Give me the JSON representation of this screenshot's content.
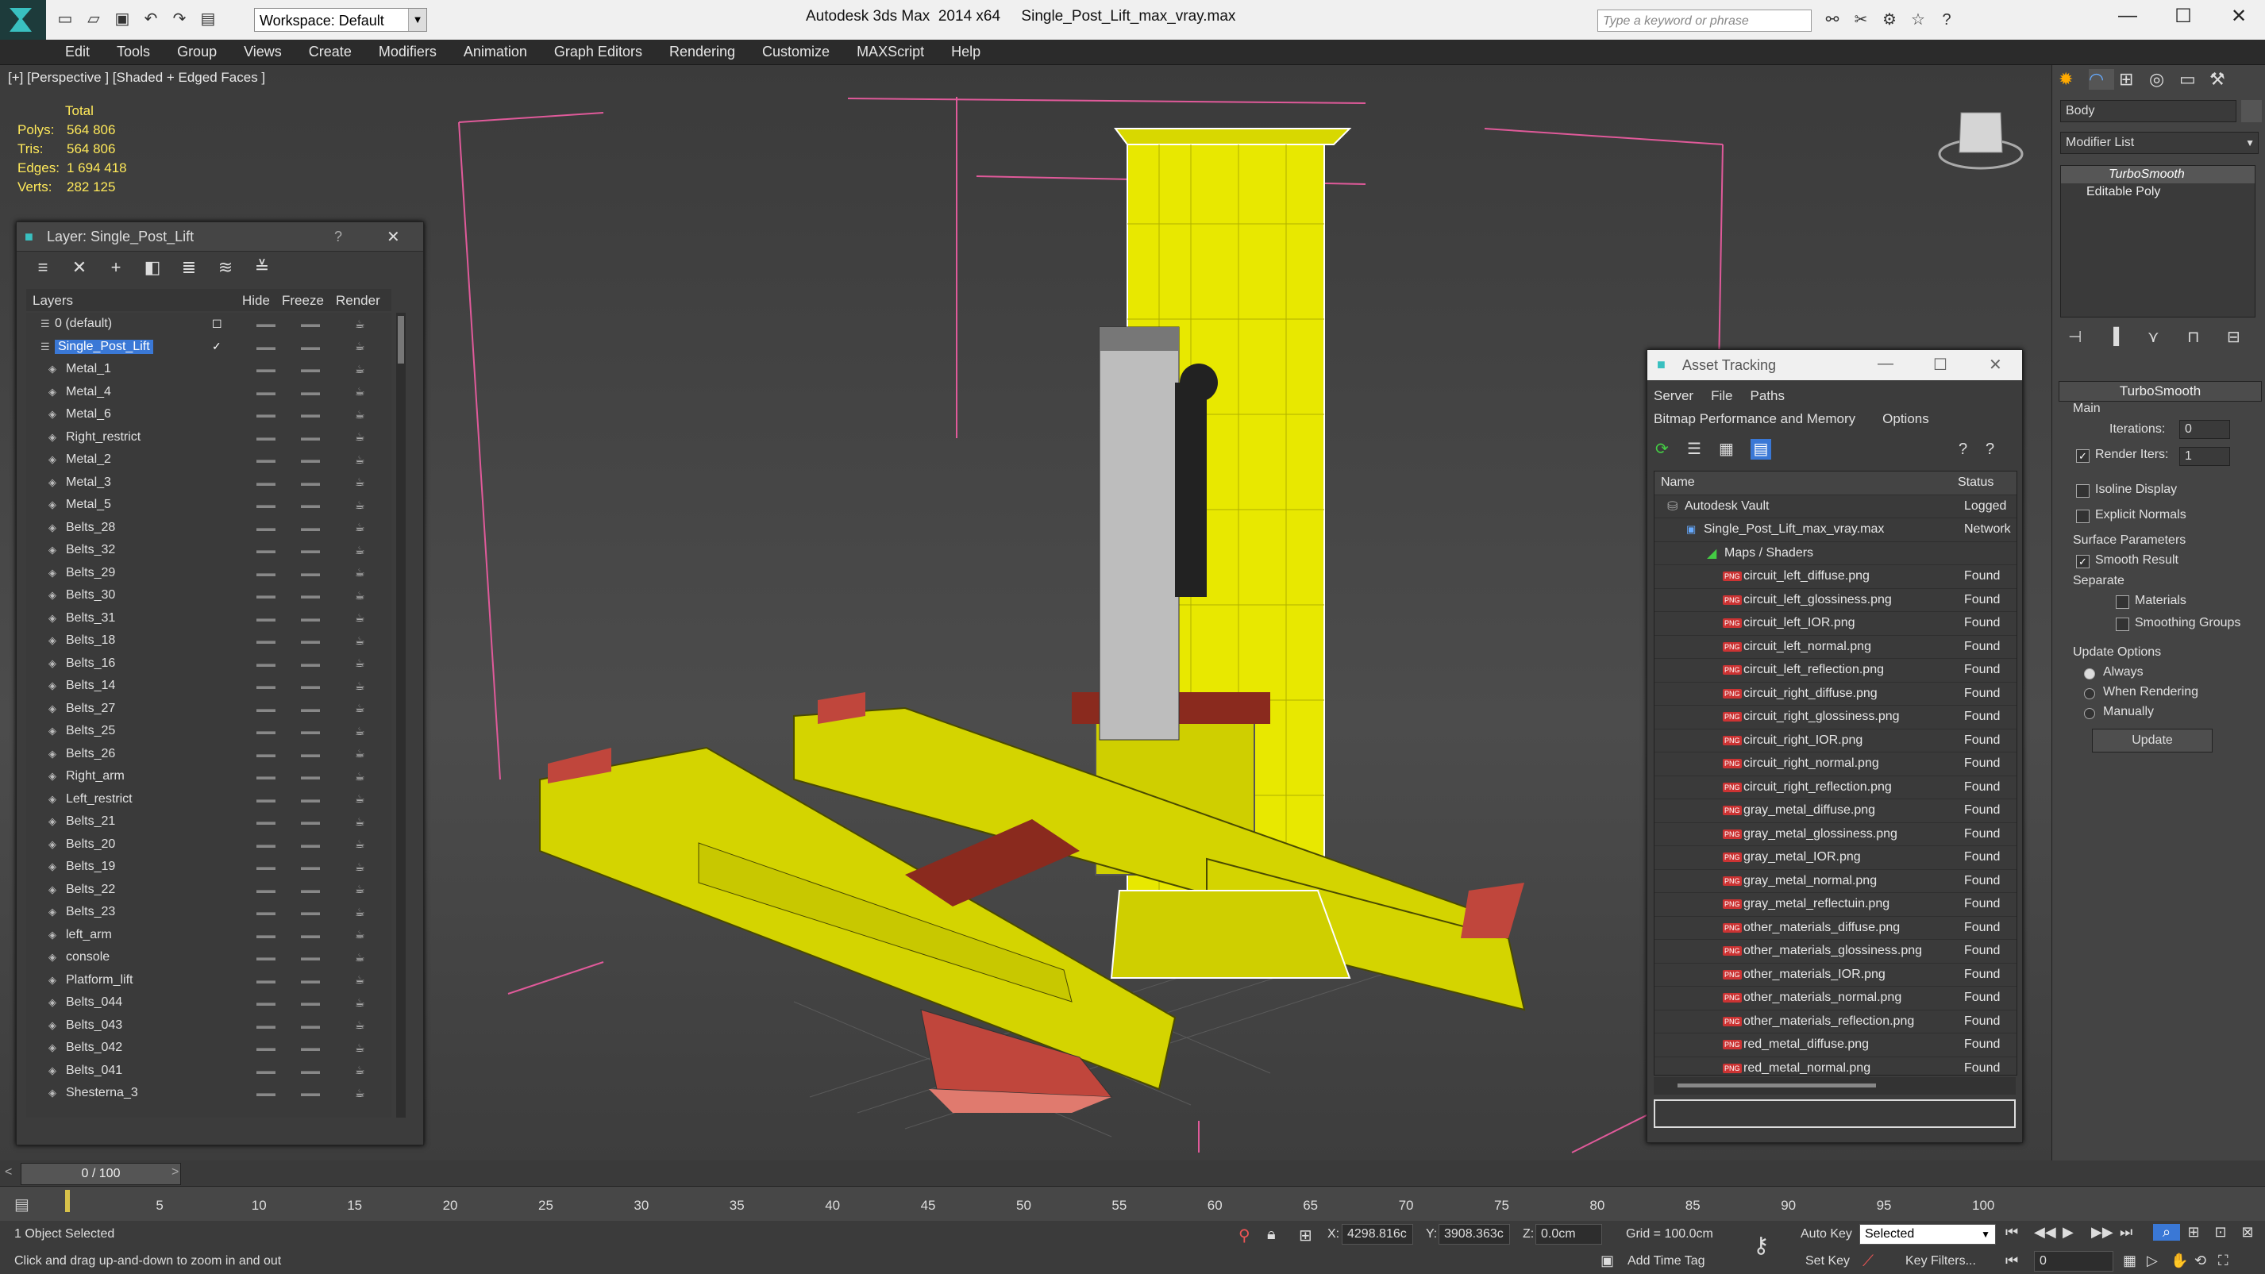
{
  "app": {
    "title": "Autodesk 3ds Max  2014 x64     Single_Post_Lift_max_vray.max",
    "workspace": "Workspace: Default",
    "search_placeholder": "Type a keyword or phrase"
  },
  "menu": [
    "Edit",
    "Tools",
    "Group",
    "Views",
    "Create",
    "Modifiers",
    "Animation",
    "Graph Editors",
    "Rendering",
    "Customize",
    "MAXScript",
    "Help"
  ],
  "viewport": {
    "label": "[+] [Perspective ] [Shaded + Edged Faces ]",
    "stats": {
      "header": "Total",
      "rows": [
        {
          "k": "Polys:",
          "v": "564 806"
        },
        {
          "k": "Tris:",
          "v": "564 806"
        },
        {
          "k": "Edges:",
          "v": "1 694 418"
        },
        {
          "k": "Verts:",
          "v": "282 125"
        }
      ]
    }
  },
  "layer_panel": {
    "title": "Layer: Single_Post_Lift",
    "help": "?",
    "columns": {
      "layers": "Layers",
      "hide": "Hide",
      "freeze": "Freeze",
      "render": "Render"
    },
    "rows": [
      "0 (default)",
      "Single_Post_Lift",
      "Metal_1",
      "Metal_4",
      "Metal_6",
      "Right_restrict",
      "Metal_2",
      "Metal_3",
      "Metal_5",
      "Belts_28",
      "Belts_32",
      "Belts_29",
      "Belts_30",
      "Belts_31",
      "Belts_18",
      "Belts_16",
      "Belts_14",
      "Belts_27",
      "Belts_25",
      "Belts_26",
      "Right_arm",
      "Left_restrict",
      "Belts_21",
      "Belts_20",
      "Belts_19",
      "Belts_22",
      "Belts_23",
      "left_arm",
      "console",
      "Platform_lift",
      "Belts_044",
      "Belts_043",
      "Belts_042",
      "Belts_041",
      "Shesterna_3"
    ],
    "selected": "Single_Post_Lift"
  },
  "asset_panel": {
    "title": "Asset Tracking",
    "menu1": [
      "Server",
      "File",
      "Paths"
    ],
    "menu2": [
      "Bitmap Performance and Memory",
      "Options"
    ],
    "columns": {
      "name": "Name",
      "status": "Status"
    },
    "rows": [
      {
        "name": "Autodesk Vault",
        "status": "Logged",
        "level": 0
      },
      {
        "name": "Single_Post_Lift_max_vray.max",
        "status": "Network",
        "level": 1
      },
      {
        "name": "Maps / Shaders",
        "status": "",
        "level": 2
      },
      {
        "name": "circuit_left_diffuse.png",
        "status": "Found",
        "level": 3
      },
      {
        "name": "circuit_left_glossiness.png",
        "status": "Found",
        "level": 3
      },
      {
        "name": "circuit_left_IOR.png",
        "status": "Found",
        "level": 3
      },
      {
        "name": "circuit_left_normal.png",
        "status": "Found",
        "level": 3
      },
      {
        "name": "circuit_left_reflection.png",
        "status": "Found",
        "level": 3
      },
      {
        "name": "circuit_right_diffuse.png",
        "status": "Found",
        "level": 3
      },
      {
        "name": "circuit_right_glossiness.png",
        "status": "Found",
        "level": 3
      },
      {
        "name": "circuit_right_IOR.png",
        "status": "Found",
        "level": 3
      },
      {
        "name": "circuit_right_normal.png",
        "status": "Found",
        "level": 3
      },
      {
        "name": "circuit_right_reflection.png",
        "status": "Found",
        "level": 3
      },
      {
        "name": "gray_metal_diffuse.png",
        "status": "Found",
        "level": 3
      },
      {
        "name": "gray_metal_glossiness.png",
        "status": "Found",
        "level": 3
      },
      {
        "name": "gray_metal_IOR.png",
        "status": "Found",
        "level": 3
      },
      {
        "name": "gray_metal_normal.png",
        "status": "Found",
        "level": 3
      },
      {
        "name": "gray_metal_reflectuin.png",
        "status": "Found",
        "level": 3
      },
      {
        "name": "other_materials_diffuse.png",
        "status": "Found",
        "level": 3
      },
      {
        "name": "other_materials_glossiness.png",
        "status": "Found",
        "level": 3
      },
      {
        "name": "other_materials_IOR.png",
        "status": "Found",
        "level": 3
      },
      {
        "name": "other_materials_normal.png",
        "status": "Found",
        "level": 3
      },
      {
        "name": "other_materials_reflection.png",
        "status": "Found",
        "level": 3
      },
      {
        "name": "red_metal_diffuse.png",
        "status": "Found",
        "level": 3
      },
      {
        "name": "red_metal_normal.png",
        "status": "Found",
        "level": 3
      }
    ]
  },
  "command_panel": {
    "object_name": "Body",
    "modifier_list": "Modifier List",
    "stack": [
      "TurboSmooth",
      "Editable Poly"
    ],
    "rollout": "TurboSmooth",
    "main": "Main",
    "iterations_label": "Iterations:",
    "iterations_value": "0",
    "render_iters_label": "Render Iters:",
    "render_iters_value": "1",
    "isoline": "Isoline Display",
    "explicit": "Explicit Normals",
    "surface": "Surface Parameters",
    "smooth_result": "Smooth Result",
    "separate": "Separate",
    "materials": "Materials",
    "smoothing_groups": "Smoothing Groups",
    "update_options": "Update Options",
    "always": "Always",
    "when_rendering": "When Rendering",
    "manually": "Manually",
    "update_btn": "Update"
  },
  "timeline": {
    "frame": "0 / 100",
    "ticks": [
      "5",
      "10",
      "15",
      "20",
      "25",
      "30",
      "35",
      "40",
      "45",
      "50",
      "55",
      "60",
      "65",
      "70",
      "75",
      "80",
      "85",
      "90",
      "95",
      "100"
    ]
  },
  "status": {
    "selected": "1 Object Selected",
    "prompt": "Click and drag up-and-down to zoom in and out",
    "x_label": "X:",
    "x_value": "4298.816c",
    "y_label": "Y:",
    "y_value": "3908.363c",
    "z_label": "Z:",
    "z_value": "0.0cm",
    "grid": "Grid = 100.0cm",
    "add_time_tag": "Add Time Tag",
    "auto_key": "Auto Key",
    "set_key": "Set Key",
    "selected_mode": "Selected",
    "key_filters": "Key Filters...",
    "frame_field": "0"
  },
  "colors": {
    "stat_yellow": "#ffe95a",
    "selection_blue": "#3a78d6",
    "model_yellow": "#e6e600",
    "model_red": "#c0463c"
  }
}
